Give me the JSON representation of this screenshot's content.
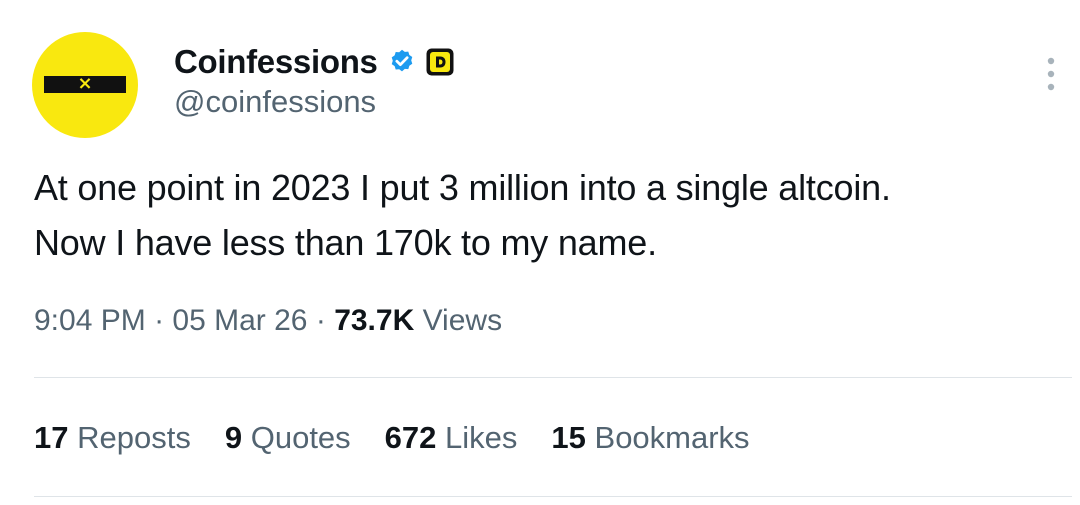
{
  "author": {
    "display_name": "Coinfessions",
    "handle": "@coinfessions",
    "avatar_mark": "×",
    "verified_icon": "verified-badge-icon",
    "extra_badge_icon": "affiliate-badge-icon",
    "brand_color": "#f9e80f",
    "verified_color": "#1d9bf0"
  },
  "tweet": {
    "line1": "At one point in 2023 I put 3 million into a single altcoin.",
    "line2": "Now I have less than 170k to my name."
  },
  "meta": {
    "time": "9:04 PM",
    "separator": "·",
    "date": "05 Mar 26",
    "views_count": "73.7K",
    "views_label": "Views"
  },
  "stats": [
    {
      "count": "17",
      "label": "Reposts"
    },
    {
      "count": "9",
      "label": "Quotes"
    },
    {
      "count": "672",
      "label": "Likes"
    },
    {
      "count": "15",
      "label": "Bookmarks"
    }
  ]
}
